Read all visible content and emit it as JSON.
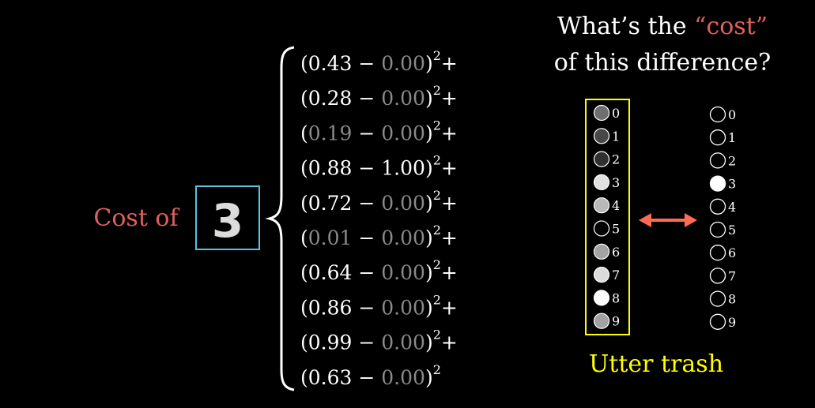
{
  "question": {
    "line1_before": "What’s the ",
    "line1_highlight": "“cost”",
    "line2": "of this difference?"
  },
  "cost_label": "Cost of",
  "digit_glyph": "3",
  "trash_label": "Utter trash",
  "colors": {
    "background": "#000000",
    "cost_red": "#e0605a",
    "frame_blue": "#58c4dd",
    "frame_yellow": "#ffff00",
    "arrow": "#ff6a57",
    "dim_gray": "#8a8a8a",
    "white": "#ffffff"
  },
  "terms": [
    {
      "a": "0.43",
      "b": "0.00",
      "a_dim": false,
      "b_dim": true,
      "suffix": "+"
    },
    {
      "a": "0.28",
      "b": "0.00",
      "a_dim": false,
      "b_dim": true,
      "suffix": "+"
    },
    {
      "a": "0.19",
      "b": "0.00",
      "a_dim": true,
      "b_dim": true,
      "suffix": "+"
    },
    {
      "a": "0.88",
      "b": "1.00",
      "a_dim": false,
      "b_dim": false,
      "suffix": "+"
    },
    {
      "a": "0.72",
      "b": "0.00",
      "a_dim": false,
      "b_dim": true,
      "suffix": "+"
    },
    {
      "a": "0.01",
      "b": "0.00",
      "a_dim": true,
      "b_dim": true,
      "suffix": "+"
    },
    {
      "a": "0.64",
      "b": "0.00",
      "a_dim": false,
      "b_dim": true,
      "suffix": "+"
    },
    {
      "a": "0.86",
      "b": "0.00",
      "a_dim": false,
      "b_dim": true,
      "suffix": "+"
    },
    {
      "a": "0.99",
      "b": "0.00",
      "a_dim": false,
      "b_dim": true,
      "suffix": "+"
    },
    {
      "a": "0.63",
      "b": "0.00",
      "a_dim": false,
      "b_dim": true,
      "suffix": ""
    }
  ],
  "exponent": "2",
  "minus_sign": "−",
  "network_output": [
    {
      "label": "0",
      "activation": 0.43
    },
    {
      "label": "1",
      "activation": 0.28
    },
    {
      "label": "2",
      "activation": 0.19
    },
    {
      "label": "3",
      "activation": 0.88
    },
    {
      "label": "4",
      "activation": 0.72
    },
    {
      "label": "5",
      "activation": 0.01
    },
    {
      "label": "6",
      "activation": 0.64
    },
    {
      "label": "7",
      "activation": 0.86
    },
    {
      "label": "8",
      "activation": 0.99
    },
    {
      "label": "9",
      "activation": 0.63
    }
  ],
  "desired_output": [
    {
      "label": "0",
      "activation": 0
    },
    {
      "label": "1",
      "activation": 0
    },
    {
      "label": "2",
      "activation": 0
    },
    {
      "label": "3",
      "activation": 1
    },
    {
      "label": "4",
      "activation": 0
    },
    {
      "label": "5",
      "activation": 0
    },
    {
      "label": "6",
      "activation": 0
    },
    {
      "label": "7",
      "activation": 0
    },
    {
      "label": "8",
      "activation": 0
    },
    {
      "label": "9",
      "activation": 0
    }
  ]
}
